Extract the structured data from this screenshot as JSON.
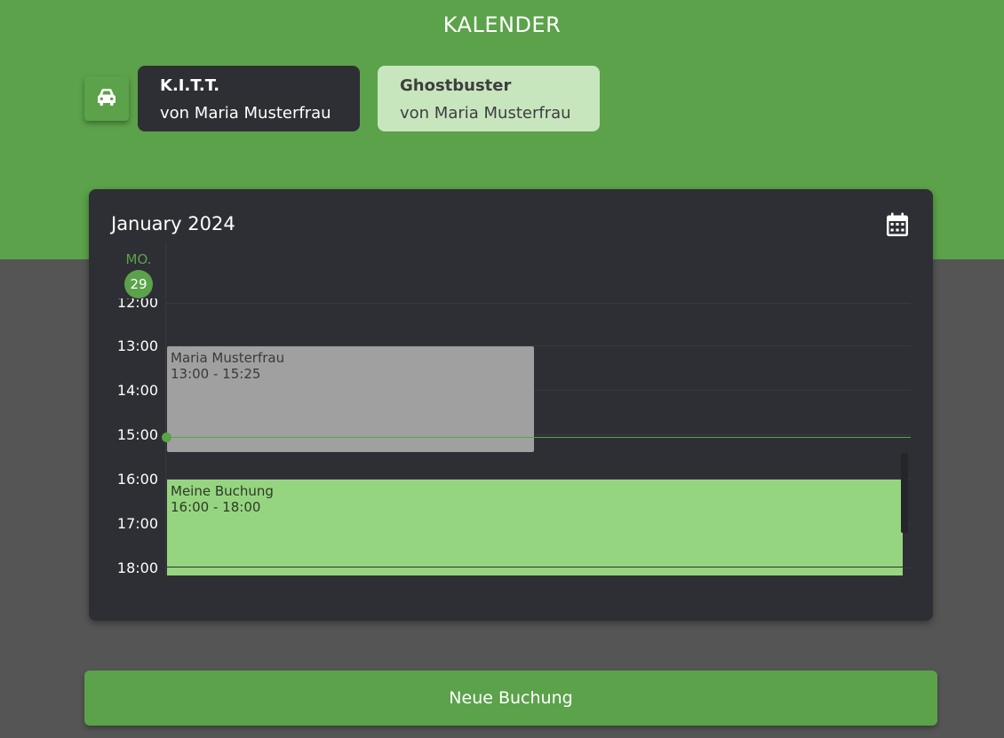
{
  "header": {
    "title": "KALENDER"
  },
  "vehicles": [
    {
      "name": "K.I.T.T.",
      "owner": "von Maria Musterfrau",
      "selected": true
    },
    {
      "name": "Ghostbuster",
      "owner": "von Maria Musterfrau",
      "selected": false
    }
  ],
  "vehicle_button": {
    "icon": "car-icon"
  },
  "calendar": {
    "month": "January 2024",
    "icon": "calendar-icon",
    "day": {
      "name": "MO.",
      "number": "29"
    },
    "time_labels": [
      "12:00",
      "13:00",
      "14:00",
      "15:00",
      "16:00",
      "17:00",
      "18:00"
    ],
    "events": [
      {
        "title": "Maria Musterfrau",
        "time": "13:00 - 15:25",
        "owner": "other"
      },
      {
        "title": "Meine Buchung",
        "time": "16:00 - 18:00",
        "owner": "mine"
      }
    ],
    "current_time_indicator": "15:05"
  },
  "actions": {
    "new_booking": "Neue Buchung"
  },
  "colors": {
    "brand_green": "#5ba24a",
    "dark_card": "#2e2f34",
    "page_background": "#555555",
    "own_booking": "#96d580",
    "other_booking": "#a0a0a0",
    "unselected_vehicle": "#c8e6be"
  }
}
